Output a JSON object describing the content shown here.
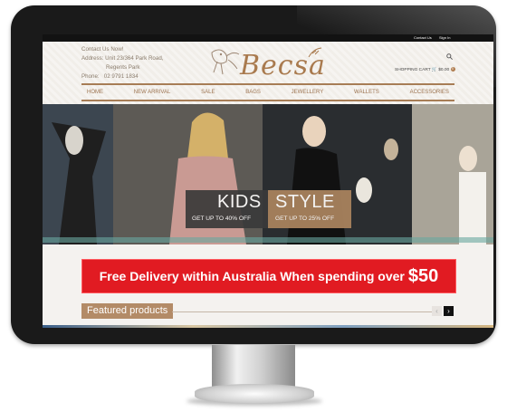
{
  "topbar": {
    "contact_us": "Contact Us",
    "sign_in": "Sign In"
  },
  "contact": {
    "heading": "Contact Us Now!",
    "address_label": "Address:",
    "address_line1": "Unit 23/364 Park Road,",
    "address_line2": "Regents Park",
    "phone_label": "Phone:",
    "phone": "02 9791 1834"
  },
  "logo": {
    "text": "Becsa"
  },
  "cart": {
    "label": "SHOPPING CART",
    "amount": "$0.00",
    "count": "0"
  },
  "nav": {
    "items": [
      "HOME",
      "NEW ARRIVAL",
      "SALE",
      "BAGS",
      "JEWELLERY",
      "WALLETS",
      "ACCESSORIES"
    ]
  },
  "hero": {
    "kids": {
      "title": "KIDS",
      "offer": "GET UP TO 40% OFF"
    },
    "style": {
      "title": "STYLE",
      "offer": "GET UP TO 25% OFF"
    }
  },
  "promo": {
    "text": "Free Delivery within Australia When spending over",
    "amount": "$50"
  },
  "featured": {
    "title": "Featured products",
    "prev": "‹",
    "next": "›"
  },
  "colors": {
    "brand": "#a97a4e",
    "accent_red": "#e11b22",
    "nav": "#9c7350",
    "topbar": "#121212"
  },
  "icons": {
    "search": "search-icon",
    "cart": "cart-icon"
  }
}
